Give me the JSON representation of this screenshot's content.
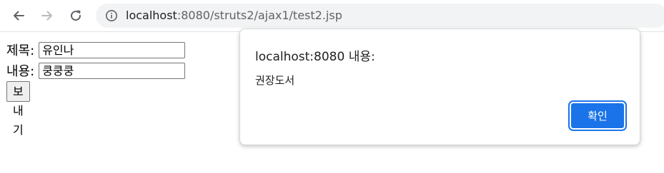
{
  "browser": {
    "url_host": "localhost",
    "url_rest": ":8080/struts2/ajax1/test2.jsp",
    "icons": {
      "back": "arrow-left-icon",
      "forward": "arrow-right-icon",
      "reload": "reload-icon",
      "site_info": "info-circle-icon"
    }
  },
  "form": {
    "title_label": "제목:",
    "title_value": "유인나",
    "content_label": "내용:",
    "content_value": "쿵쿵쿵",
    "send_label": "보내기"
  },
  "dialog": {
    "title": "localhost:8080 내용:",
    "message": "권장도서",
    "ok_label": "확인",
    "accent_color": "#1a73e8"
  }
}
